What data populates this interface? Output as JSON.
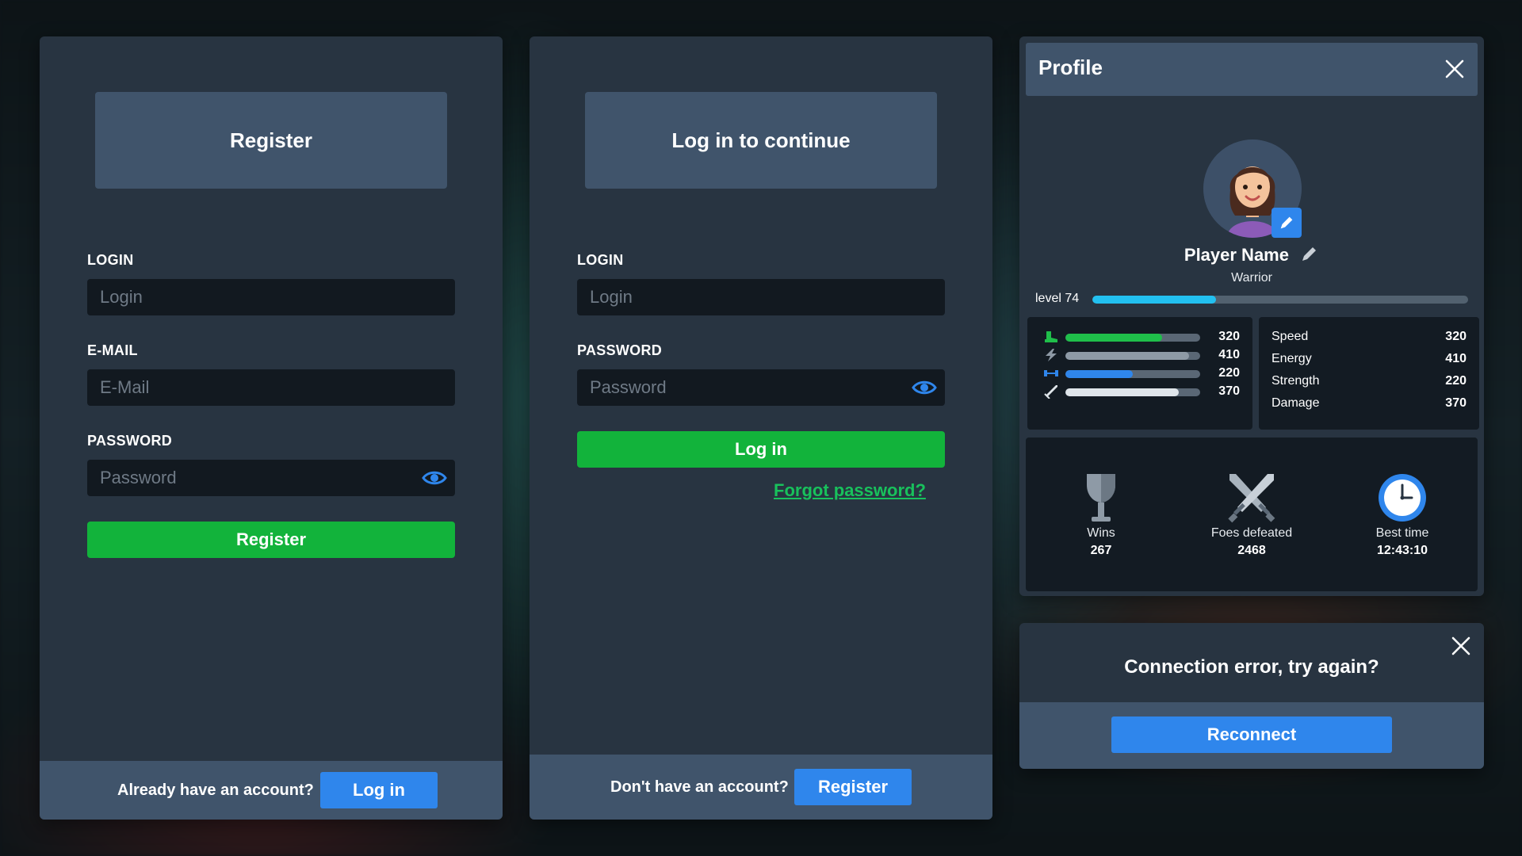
{
  "register_panel": {
    "title": "Register",
    "login_label": "LOGIN",
    "login_placeholder": "Login",
    "email_label": "E-MAIL",
    "email_placeholder": "E-Mail",
    "password_label": "PASSWORD",
    "password_placeholder": "Password",
    "submit_label": "Register",
    "footer_text": "Already have an account?",
    "footer_button": "Log in"
  },
  "login_panel": {
    "title": "Log in to continue",
    "login_label": "LOGIN",
    "login_placeholder": "Login",
    "password_label": "PASSWORD",
    "password_placeholder": "Password",
    "submit_label": "Log in",
    "forgot_link": "Forgot password?",
    "footer_text": "Don't have an account?",
    "footer_button": "Register"
  },
  "profile": {
    "title": "Profile",
    "player_name": "Player Name",
    "player_class": "Warrior",
    "level_label": "level 74",
    "level_progress": 0.33,
    "bars": [
      {
        "icon": "boot-icon",
        "value": "320",
        "fraction": 0.72,
        "color": "#1fbf4a"
      },
      {
        "icon": "lightning-icon",
        "value": "410",
        "fraction": 0.92,
        "color": "#8e9aa6"
      },
      {
        "icon": "dumbbell-icon",
        "value": "220",
        "fraction": 0.5,
        "color": "#2f86ec"
      },
      {
        "icon": "sword-icon",
        "value": "370",
        "fraction": 0.84,
        "color": "#dfe5ea"
      }
    ],
    "stats": [
      {
        "name": "Speed",
        "value": "320"
      },
      {
        "name": "Energy",
        "value": "410"
      },
      {
        "name": "Strength",
        "value": "220"
      },
      {
        "name": "Damage",
        "value": "370"
      }
    ],
    "achievements": [
      {
        "icon": "trophy-icon",
        "label": "Wins",
        "value": "267"
      },
      {
        "icon": "crossed-swords-icon",
        "label": "Foes defeated",
        "value": "2468"
      },
      {
        "icon": "clock-icon",
        "label": "Best time",
        "value": "12:43:10"
      }
    ]
  },
  "error_dialog": {
    "message": "Connection error, try again?",
    "button": "Reconnect"
  },
  "colors": {
    "panel": "#283441",
    "header": "#40546b",
    "input": "#121920",
    "green": "#12b33b",
    "blue": "#2f86ec",
    "link": "#18c15c",
    "level": "#22c0f0"
  }
}
